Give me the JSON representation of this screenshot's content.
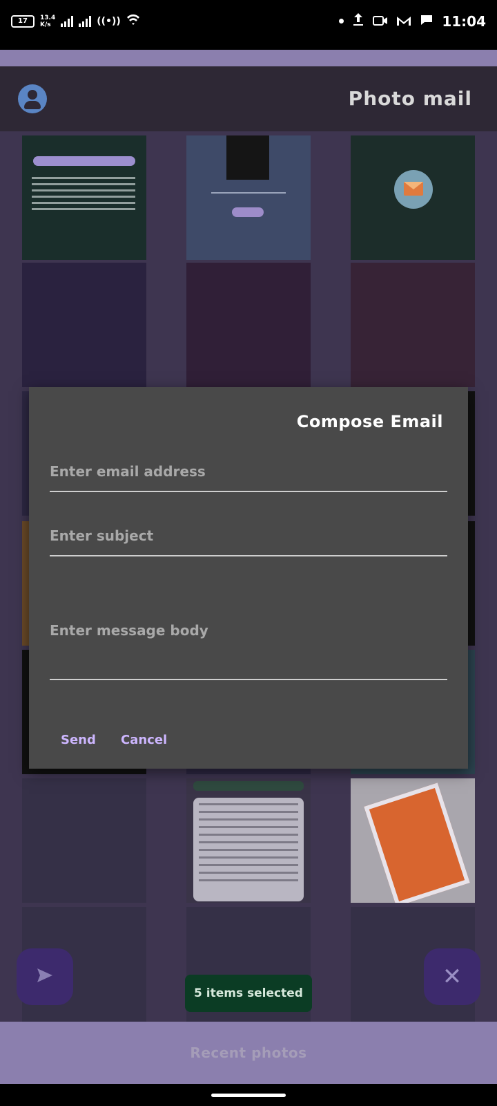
{
  "status_bar": {
    "battery": "17",
    "net_speed_value": "13.4",
    "net_speed_unit": "K/s",
    "time": "11:04"
  },
  "app_bar": {
    "title": "Photo mail"
  },
  "dialog": {
    "title": "Compose Email",
    "email_placeholder": "Enter email address",
    "subject_placeholder": "Enter subject",
    "body_placeholder": "Enter message body",
    "send_label": "Send",
    "cancel_label": "Cancel"
  },
  "selection": {
    "label": "5 items selected"
  },
  "bottom_bar": {
    "label": "Recent photos"
  },
  "icons": {
    "send_fab": "send-icon",
    "close_fab": "close-icon",
    "avatar": "account-icon"
  }
}
